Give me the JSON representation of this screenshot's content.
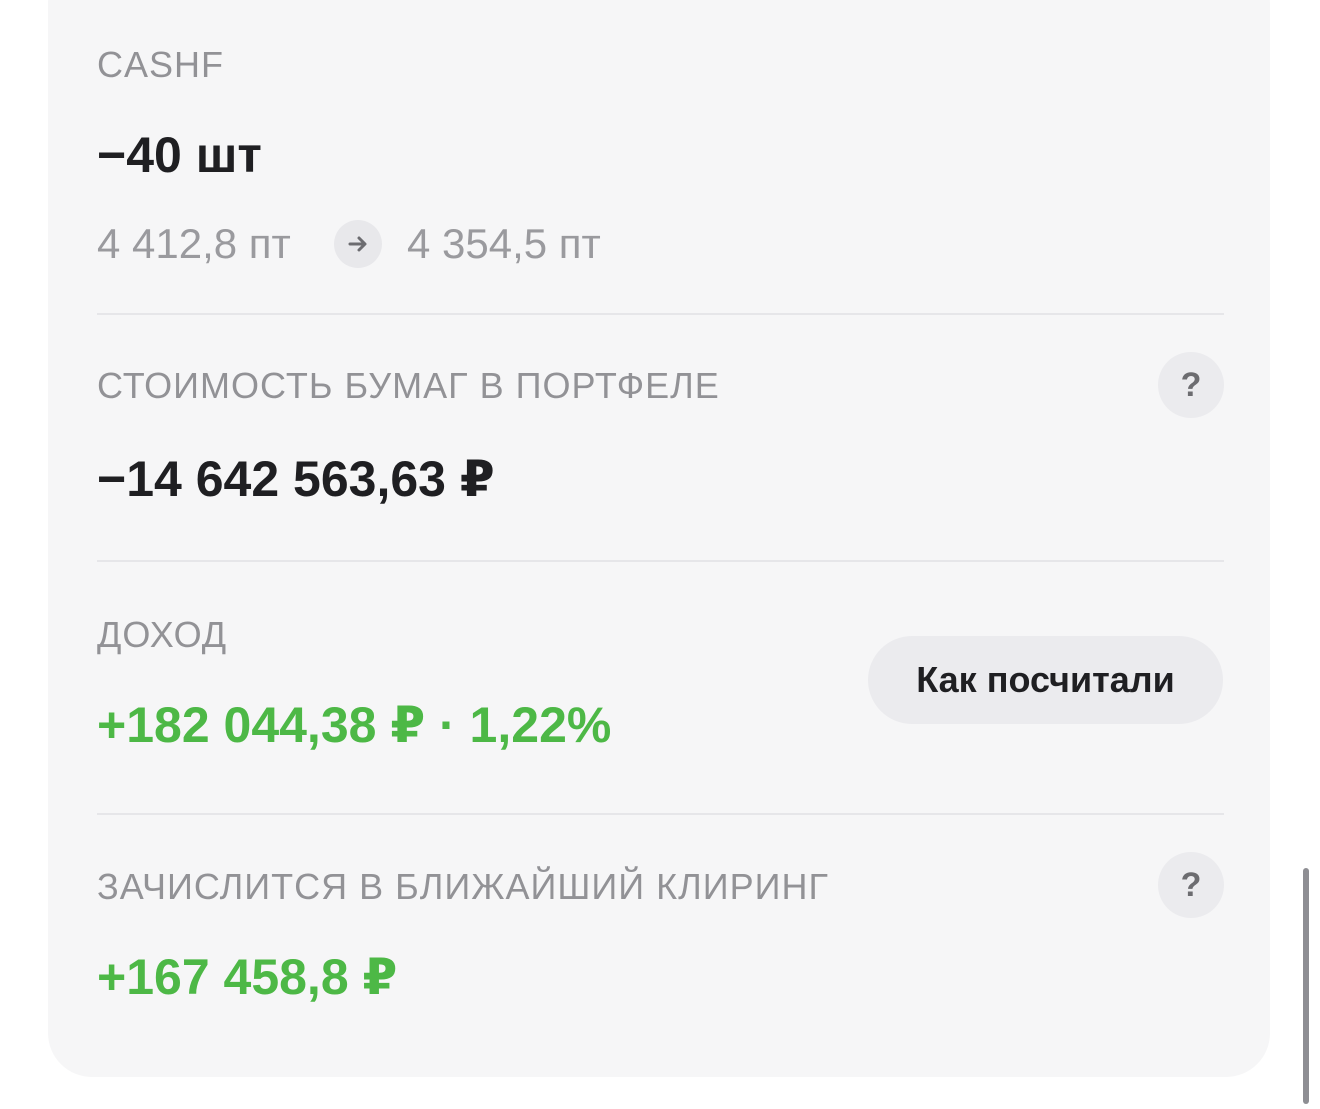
{
  "position": {
    "ticker": "CASHF",
    "quantity": "−40 шт",
    "price_from": "4 412,8 пт",
    "price_to": "4 354,5 пт",
    "arrow_icon": "arrow-right-icon"
  },
  "portfolio_value": {
    "label": "СТОИМОСТЬ БУМАГ В ПОРТФЕЛЕ",
    "value": "−14 642 563,63 ₽",
    "help_icon": "?"
  },
  "income": {
    "label": "ДОХОД",
    "value": "+182 044,38 ₽ · 1,22%",
    "button_label": "Как посчитали",
    "color": "#4db846"
  },
  "clearing": {
    "label": "ЗАЧИСЛИТСЯ В БЛИЖАЙШИЙ КЛИРИНГ",
    "value": "+167 458,8 ₽",
    "help_icon": "?",
    "color": "#4db846"
  }
}
